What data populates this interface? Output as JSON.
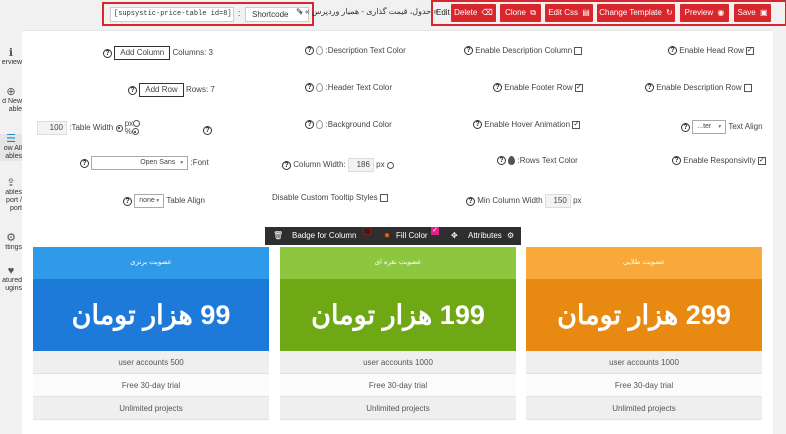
{
  "sidebar": {
    "items": [
      {
        "icon": "info-icon",
        "glyph": "ℹ",
        "label": "erview"
      },
      {
        "icon": "add-icon",
        "glyph": "⊕",
        "label": "d New\nable"
      },
      {
        "icon": "list-icon",
        "glyph": "☰",
        "label": "ow All\nables"
      },
      {
        "icon": "upload-icon",
        "glyph": "⇪",
        "label": "ables\nport /\nport"
      },
      {
        "icon": "gear-icon",
        "glyph": "⚙",
        "label": "ttings"
      },
      {
        "icon": "heart-icon",
        "glyph": "♥",
        "label": "atured\nugins"
      }
    ]
  },
  "toolbar": {
    "shortcode_value": "[supsystic-price-table id=8]",
    "shortcode_colon": ":",
    "shortcode_select": "Shortcode",
    "title_text": "« حدول، قیمت گذاری - همیار وردپرس »",
    "edit_label": "Edit",
    "buttons": [
      {
        "label": "Delete",
        "glyph": "🗑",
        "icon": "trash-icon"
      },
      {
        "label": "Clone",
        "glyph": "⧉",
        "icon": "clone-icon"
      },
      {
        "label": "Edit Css",
        "glyph": "▤",
        "icon": "css-icon"
      },
      {
        "label": "Change Template",
        "glyph": "↻",
        "icon": "refresh-icon"
      },
      {
        "label": "Preview",
        "glyph": "◉",
        "icon": "eye-icon"
      },
      {
        "label": "Save",
        "glyph": "▣",
        "icon": "save-icon"
      }
    ]
  },
  "settings": {
    "add_column_button": "Add Column",
    "columns_label": "Columns: 3",
    "add_row_button": "Add Row",
    "rows_label": "Rows: 7",
    "table_width_value": "100",
    "table_width_label": ":Table Width",
    "px_label": "px",
    "percent_label": "%",
    "font_value": "Open Sans",
    "font_label": ":Font",
    "table_align_value": "none",
    "table_align_label": "Table Align",
    "desc_text_color_label": ":Description Text Color",
    "header_text_color_label": ":Header Text Color",
    "bg_color_label": ":Background Color",
    "column_width_label": "Column Width:",
    "column_width_value": "186",
    "column_width_unit": "px",
    "disable_tooltip_label": "Disable Custom Tooltip Styles",
    "enable_desc_column_label": "Enable Description Column",
    "enable_footer_row_label": "Enable Footer Row",
    "enable_hover_label": "Enable Hover Animation",
    "rows_text_color_label": ":Rows Text Color",
    "min_col_width_label": "Min Column Width",
    "min_col_width_value": "150",
    "min_col_width_unit": "px",
    "enable_head_row_label": "Enable Head Row",
    "enable_desc_row_label": "Enable Description Row",
    "text_align_value": "...ter",
    "text_align_label": "Text Align",
    "enable_responsivity_label": "Enable Responsivity",
    "help_mark": "?",
    "check_mark": "✓"
  },
  "column_toolbar": {
    "badge_label": "Badge for Column",
    "fill_color_label": "Fill Color",
    "attributes_label": "Attributes"
  },
  "pricing": {
    "columns": [
      {
        "header": "عضویت برنزی",
        "price": "99 هزار تومان",
        "head_color": "#2f9ae8",
        "price_color": "#1e7ad8",
        "rows": [
          "user accounts 500",
          "Free 30-day trial",
          "Unlimited projects"
        ]
      },
      {
        "header": "عضویت نقره ای",
        "price": "199 هزار تومان",
        "head_color": "#8dc63f",
        "price_color": "#6ea814",
        "rows": [
          "user accounts 1000",
          "Free 30-day trial",
          "Unlimited projects"
        ]
      },
      {
        "header": "عضویت طلایی",
        "price": "299 هزار تومان",
        "head_color": "#f8a93a",
        "price_color": "#e88a12",
        "rows": [
          "user accounts 1000",
          "Free 30-day trial",
          "Unlimited projects"
        ]
      }
    ]
  }
}
